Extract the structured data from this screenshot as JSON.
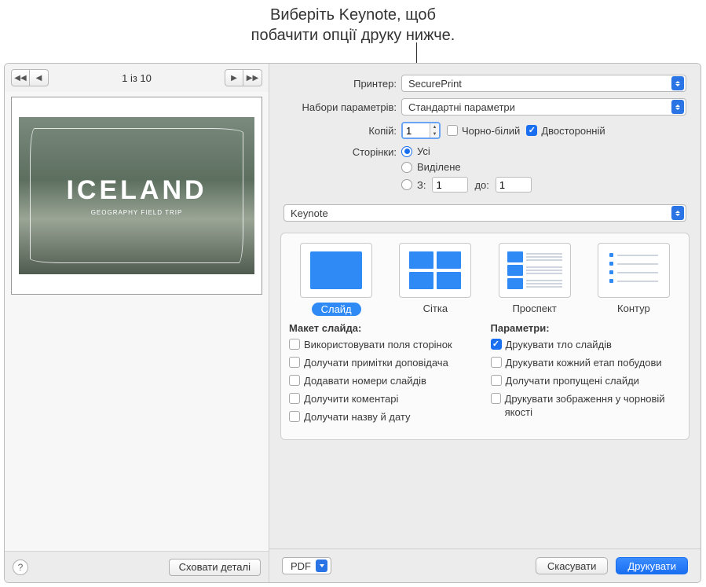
{
  "annotation": {
    "line1": "Виберіть Keynote, щоб",
    "line2": "побачити опції друку нижче."
  },
  "preview": {
    "pageCounter": "1 із 10",
    "slideTitle": "ICELAND",
    "slideSubtitle": "GEOGRAPHY FIELD TRIP",
    "hideDetails": "Сховати деталі"
  },
  "printer": {
    "label": "Принтер:",
    "value": "SecurePrint"
  },
  "presets": {
    "label": "Набори параметрів:",
    "value": "Стандартні параметри"
  },
  "copies": {
    "label": "Копій:",
    "value": "1",
    "bw": {
      "label": "Чорно-білий",
      "checked": false
    },
    "duplex": {
      "label": "Двосторонній",
      "checked": true
    }
  },
  "pages": {
    "label": "Сторінки:",
    "all": "Усі",
    "selected": "Виділене",
    "from": "З:",
    "fromValue": "1",
    "to": "до:",
    "toValue": "1"
  },
  "sectionPopup": "Keynote",
  "layouts": {
    "slide": "Слайд",
    "grid": "Сітка",
    "handout": "Проспект",
    "outline": "Контур"
  },
  "slideLayout": {
    "heading": "Макет слайда:",
    "useMargins": "Використовувати поля сторінок",
    "includeNotes": "Долучати примітки доповідача",
    "addNumbers": "Додавати номери слайдів",
    "includeComments": "Долучити коментарі",
    "includeNameDate": "Долучати назву й дату"
  },
  "params": {
    "heading": "Параметри:",
    "printBg": "Друкувати тло слайдів",
    "printBgChecked": true,
    "printBuilds": "Друкувати кожний етап побудови",
    "includeSkipped": "Долучати пропущені слайди",
    "draftImages": "Друкувати зображення у чорновій якості"
  },
  "footer": {
    "pdf": "PDF",
    "cancel": "Скасувати",
    "print": "Друкувати"
  }
}
